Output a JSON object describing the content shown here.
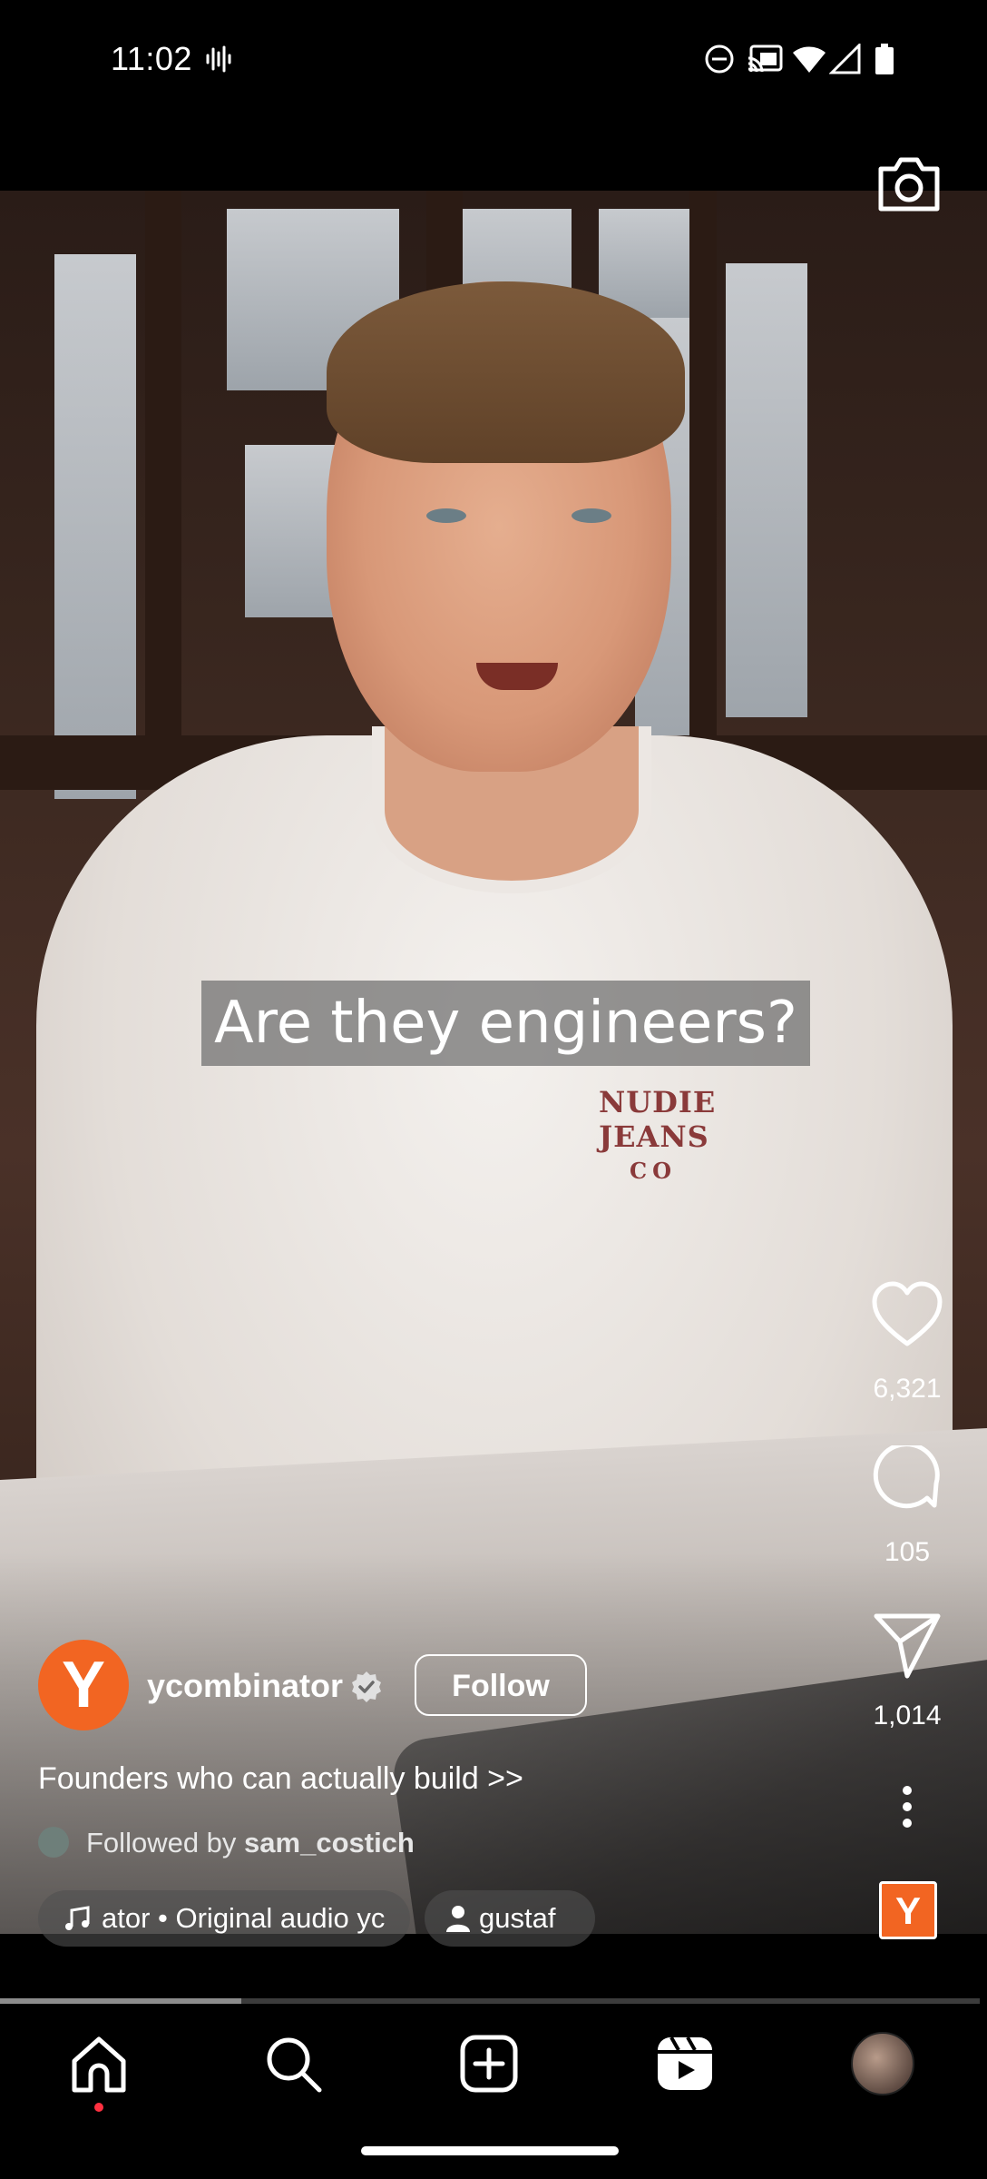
{
  "status_bar": {
    "time": "11:02"
  },
  "caption": "Are they engineers?",
  "shirt_logo": {
    "line1": "NUDIE",
    "line2": "JEANS",
    "line3": "CO"
  },
  "rail": {
    "likes": "6,321",
    "comments": "105",
    "shares": "1,014"
  },
  "author": {
    "avatar_letter": "Y",
    "username": "ycombinator",
    "follow_label": "Follow"
  },
  "description": "Founders who can actually build >>",
  "followed_by": {
    "prefix": "Followed by",
    "user": "sam_costich"
  },
  "audio_chip": {
    "text": "ator • Original audio   yc"
  },
  "people_chip": {
    "text": "gustaf"
  },
  "audio_thumb": {
    "letter": "Y"
  },
  "progress": {
    "fraction": 0.246
  },
  "colors": {
    "brand": "#f26522",
    "like_notif": "#ff3040"
  },
  "nav": {
    "items": [
      "home-icon",
      "search-icon",
      "create-icon",
      "reels-icon",
      "profile-avatar"
    ]
  }
}
